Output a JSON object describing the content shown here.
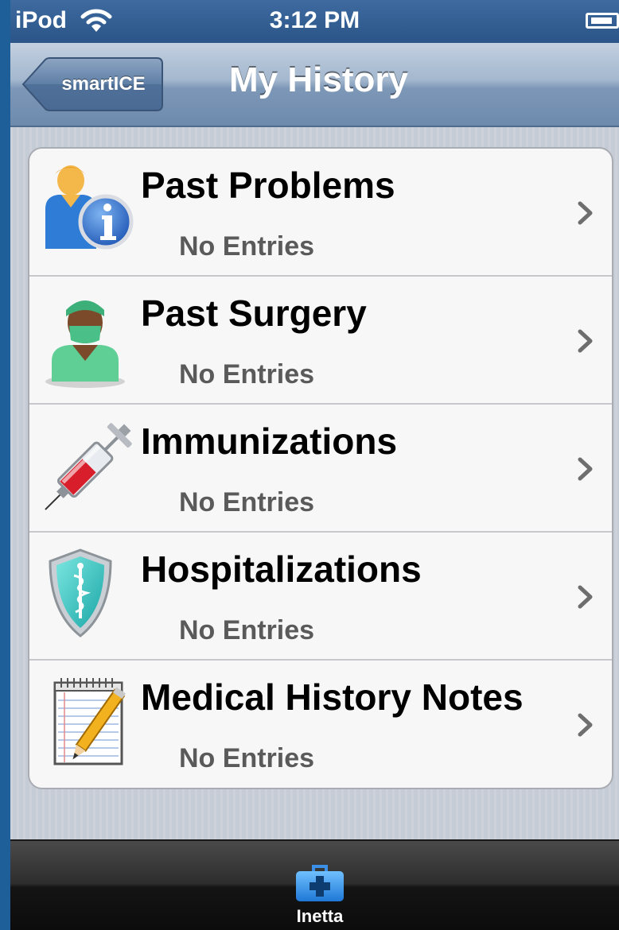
{
  "status_bar": {
    "carrier": "iPod",
    "time": "3:12 PM"
  },
  "nav": {
    "back_label": "smartICE",
    "title": "My History"
  },
  "history_items": [
    {
      "title": "Past Problems",
      "subtitle": "No Entries",
      "icon": "person-info-icon"
    },
    {
      "title": "Past Surgery",
      "subtitle": "No Entries",
      "icon": "surgeon-icon"
    },
    {
      "title": "Immunizations",
      "subtitle": "No Entries",
      "icon": "syringe-icon"
    },
    {
      "title": "Hospitalizations",
      "subtitle": "No Entries",
      "icon": "medical-shield-icon"
    },
    {
      "title": "Medical History Notes",
      "subtitle": "No Entries",
      "icon": "notepad-pencil-icon"
    }
  ],
  "tab_bar": {
    "items": [
      {
        "label": "Inetta",
        "icon": "first-aid-kit-icon"
      }
    ]
  },
  "colors": {
    "nav_bar": "#7d97b7",
    "status_bar": "#2b5588",
    "tab_bar": "#141414",
    "subtitle_text": "#5a5a5a"
  }
}
